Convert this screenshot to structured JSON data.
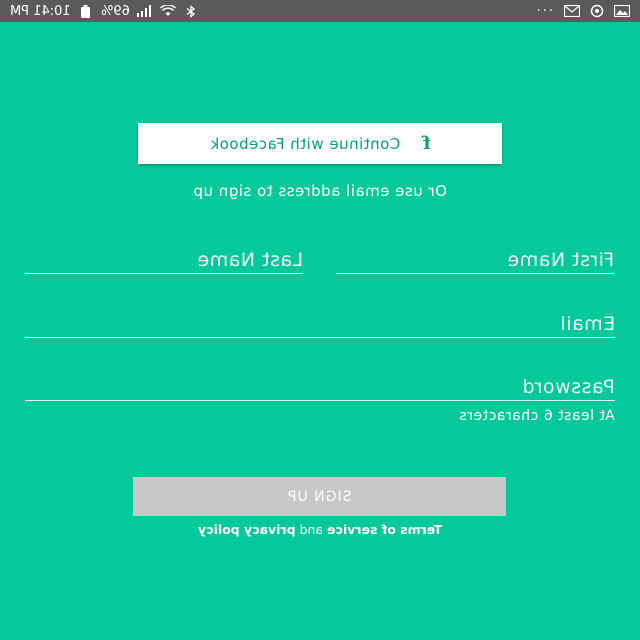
{
  "status_bar": {
    "time": "10:41 PM",
    "battery": "69%",
    "icons": [
      "bluetooth-icon",
      "wifi-icon",
      "signal-icon",
      "battery-icon",
      "more-icon",
      "mail-icon",
      "sync-icon",
      "image-icon"
    ],
    "more": "···"
  },
  "facebook_button": {
    "icon": "f",
    "label": "Continue with Facebook"
  },
  "or_text": "Or use email address to sign up",
  "fields": {
    "first_name_placeholder": "First Name",
    "last_name_placeholder": "Last Name",
    "email_placeholder": "Email",
    "password_placeholder": "Password"
  },
  "password_hint": "At least 6 characters",
  "signup_button": {
    "label": "SIGN UP"
  },
  "terms": {
    "terms_link": "Terms of service",
    "and": " and ",
    "privacy_link": "privacy policy"
  },
  "colors": {
    "background": "#05c99a",
    "status_bar": "#5a5a5a",
    "facebook_text": "#0a9e76",
    "signup_button": "#c7c7c7"
  }
}
